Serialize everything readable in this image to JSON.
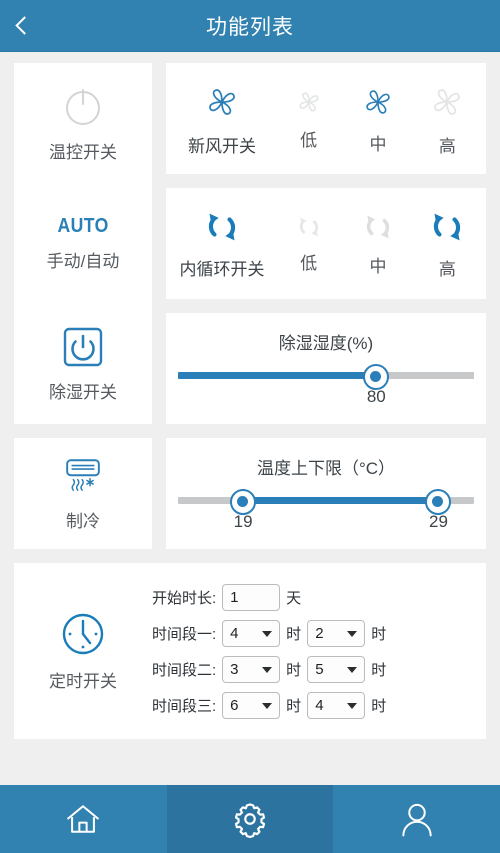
{
  "header": {
    "title": "功能列表",
    "back_icon": "chevron-left-icon",
    "bg_color": "#3182b0"
  },
  "theme": {
    "accent": "#2b7fb8",
    "accent_dark": "#2c73a0",
    "inactive": "#d2d4d6",
    "page_bg": "#efeff0",
    "card_bg": "#ffffff",
    "text": "#555b60"
  },
  "controls": {
    "temp_switch": {
      "label": "温控开关",
      "icon": "power-icon",
      "state": "off"
    },
    "auto_switch": {
      "badge": "AUTO",
      "label": "手动/自动",
      "state": "on"
    },
    "dehumidify_switch": {
      "label": "除湿开关",
      "icon": "power-box-icon",
      "state": "on"
    },
    "cooling": {
      "label": "制冷",
      "icon": "air-conditioner-icon",
      "state": "on"
    },
    "timer": {
      "label": "定时开关",
      "icon": "clock-icon",
      "state": "on"
    }
  },
  "fan_card": {
    "items": [
      {
        "label": "新风开关",
        "icon": "fan-icon",
        "state": "on"
      },
      {
        "label": "低",
        "icon": "fan-icon",
        "state": "off"
      },
      {
        "label": "中",
        "icon": "fan-icon",
        "state": "on"
      },
      {
        "label": "高",
        "icon": "fan-icon",
        "state": "off"
      }
    ]
  },
  "circulation_card": {
    "items": [
      {
        "label": "内循环开关",
        "icon": "recycle-icon",
        "state": "on"
      },
      {
        "label": "低",
        "icon": "recycle-icon",
        "state": "off"
      },
      {
        "label": "中",
        "icon": "recycle-icon",
        "state": "off"
      },
      {
        "label": "高",
        "icon": "recycle-icon",
        "state": "on"
      }
    ]
  },
  "humidity_slider": {
    "title": "除湿湿度(%)",
    "value": "80",
    "percent": 67
  },
  "temperature_slider": {
    "title": "温度上下限（°C）",
    "low_value": "19",
    "high_value": "29",
    "low_percent": 22,
    "high_percent": 88
  },
  "timer_form": {
    "duration": {
      "label": "开始时长:",
      "value": "1",
      "unit": "天"
    },
    "periods": [
      {
        "label": "时间段一:",
        "start": "4",
        "start_unit": "时",
        "end": "2",
        "end_unit": "时"
      },
      {
        "label": "时间段二:",
        "start": "3",
        "start_unit": "时",
        "end": "5",
        "end_unit": "时"
      },
      {
        "label": "时间段三:",
        "start": "6",
        "start_unit": "时",
        "end": "4",
        "end_unit": "时"
      }
    ]
  },
  "bottom_nav": {
    "items": [
      {
        "icon": "home-icon",
        "active": false
      },
      {
        "icon": "gear-icon",
        "active": true
      },
      {
        "icon": "person-icon",
        "active": false
      }
    ]
  }
}
